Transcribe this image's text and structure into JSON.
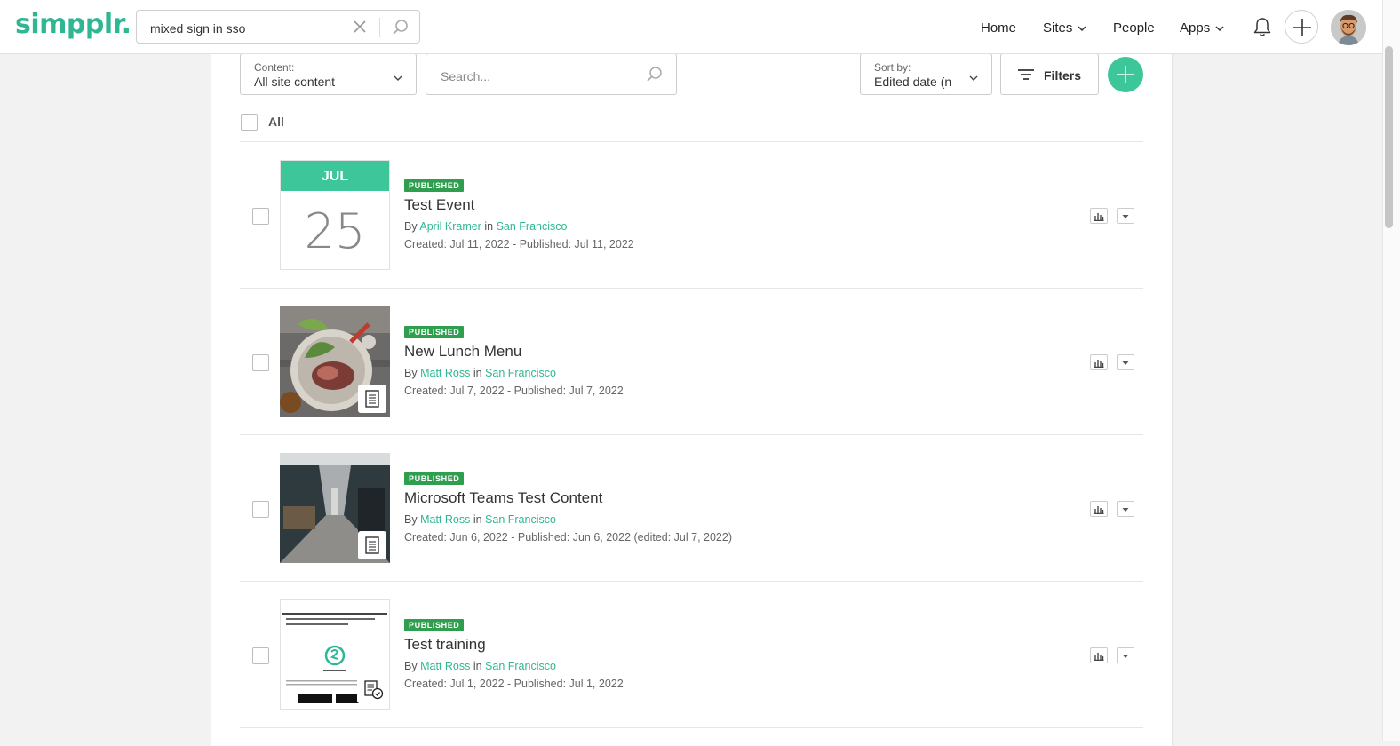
{
  "app": {
    "logo": "simpplr."
  },
  "global_search": {
    "value": "mixed sign in sso"
  },
  "nav": {
    "home": "Home",
    "sites": "Sites",
    "people": "People",
    "apps": "Apps"
  },
  "toolbar": {
    "content_label": "Content:",
    "content_value": "All site content",
    "search_placeholder": "Search...",
    "sort_label": "Sort by:",
    "sort_value": "Edited date (n",
    "filters_label": "Filters",
    "select_all_label": "All"
  },
  "colors": {
    "brand": "#2fb794",
    "accent": "#3cc69a",
    "published_badge": "#2f9e4f"
  },
  "items": [
    {
      "status": "PUBLISHED",
      "title": "Test Event",
      "by": "By",
      "author": "April Kramer",
      "in": "in",
      "site": "San Francisco",
      "dates": "Created: Jul 11, 2022 - Published: Jul 11, 2022",
      "thumb_type": "event",
      "event_month": "JUL",
      "event_day": "25"
    },
    {
      "status": "PUBLISHED",
      "title": "New Lunch Menu",
      "by": "By",
      "author": "Matt Ross",
      "in": "in",
      "site": "San Francisco",
      "dates": "Created: Jul 7, 2022 - Published: Jul 7, 2022",
      "thumb_type": "page-food-photo"
    },
    {
      "status": "PUBLISHED",
      "title": "Microsoft Teams Test Content",
      "by": "By",
      "author": "Matt Ross",
      "in": "in",
      "site": "San Francisco",
      "dates": "Created: Jun 6, 2022 - Published: Jun 6, 2022 (edited: Jul 7, 2022)",
      "thumb_type": "page-office-photo"
    },
    {
      "status": "PUBLISHED",
      "title": "Test training",
      "by": "By",
      "author": "Matt Ross",
      "in": "in",
      "site": "San Francisco",
      "dates": "Created: Jul 1, 2022 - Published: Jul 1, 2022",
      "thumb_type": "training-app-flyer"
    }
  ]
}
